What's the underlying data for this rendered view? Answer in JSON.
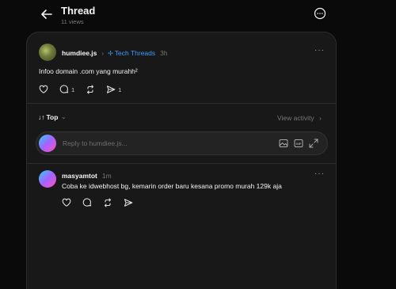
{
  "header": {
    "title": "Thread",
    "views": "11 views",
    "back_icon": "arrow-left-icon",
    "more_icon": "ellipsis-circle-icon"
  },
  "post": {
    "author": "humdiee.js",
    "topic": "Tech Threads",
    "time": "3h",
    "text": "Infoo domain .com yang murahh²",
    "replies_count": "1",
    "shares_count": "1"
  },
  "sort": {
    "label": "Top",
    "view_activity": "View activity"
  },
  "reply_box": {
    "placeholder": "Reply to humdiee.js..."
  },
  "reply": {
    "author": "masyamtot",
    "time": "1m",
    "text": "Coba ke idwebhost bg, kemarin order baru kesana promo murah 129k aja"
  },
  "colors": {
    "background": "#0a0a0a",
    "panel": "#181818",
    "accent_link": "#3e9cff",
    "muted_text": "#777777"
  }
}
